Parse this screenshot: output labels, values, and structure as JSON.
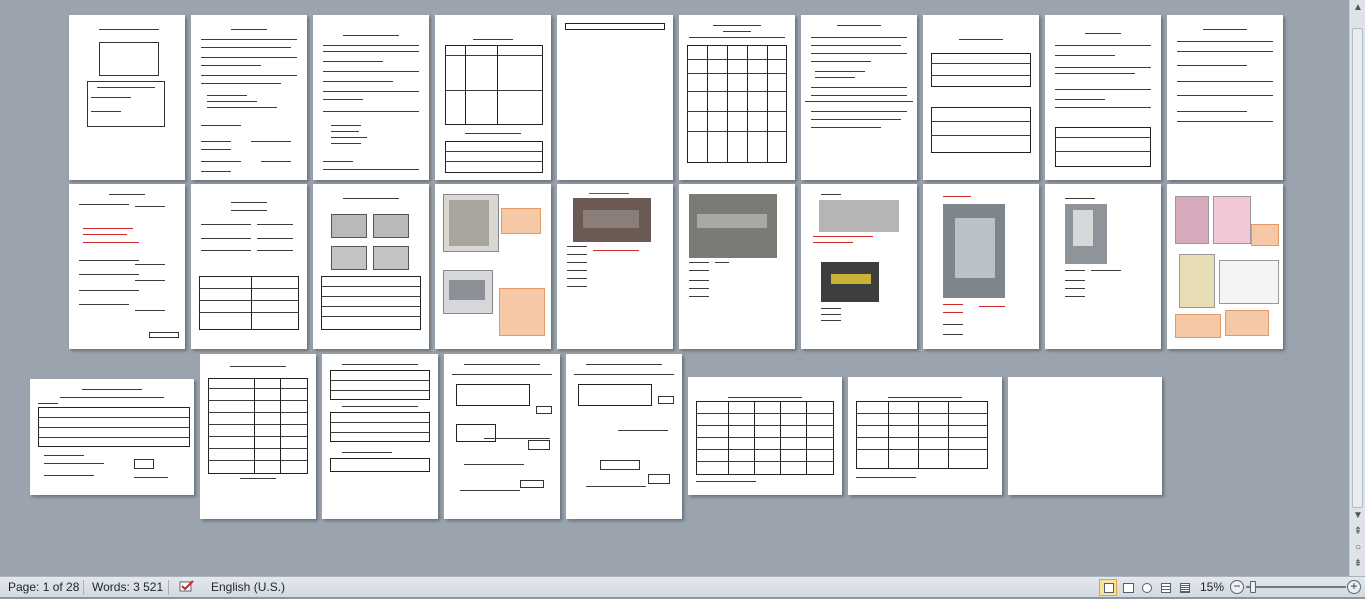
{
  "status_bar": {
    "page_label": "Page: 1 of 28",
    "words_label": "Words: 3 521",
    "language": "English (U.S.)",
    "zoom": "15%",
    "zoom_out": "−",
    "zoom_in": "+"
  },
  "document": {
    "total_pages": 28,
    "current_page": 1
  },
  "icons": {
    "proofing": "spellcheck-icon",
    "views": [
      "print-layout-icon",
      "full-screen-reading-icon",
      "web-layout-icon",
      "outline-icon",
      "draft-icon"
    ]
  },
  "colors": {
    "accent_tint": "#f6c9a6",
    "active_view": "#fbe29a"
  }
}
